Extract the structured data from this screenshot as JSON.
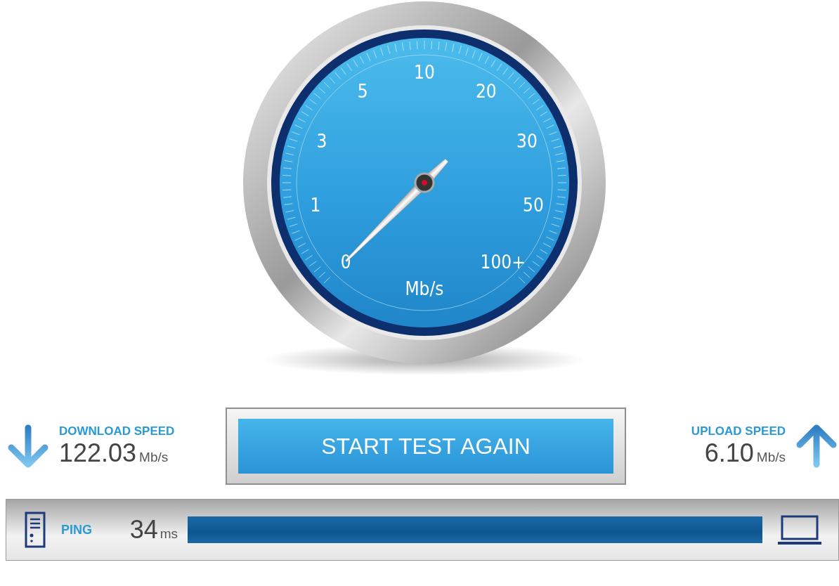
{
  "gauge": {
    "scale": [
      "0",
      "1",
      "3",
      "5",
      "10",
      "20",
      "30",
      "50",
      "100+"
    ],
    "unit": "Mb/s"
  },
  "download": {
    "label": "DOWNLOAD SPEED",
    "value": "122.03",
    "unit": "Mb/s"
  },
  "start_button": {
    "label": "START TEST AGAIN"
  },
  "upload": {
    "label": "UPLOAD SPEED",
    "value": "6.10",
    "unit": "Mb/s"
  },
  "ping": {
    "label": "PING",
    "value": "34",
    "unit": "ms",
    "level": 1
  }
}
